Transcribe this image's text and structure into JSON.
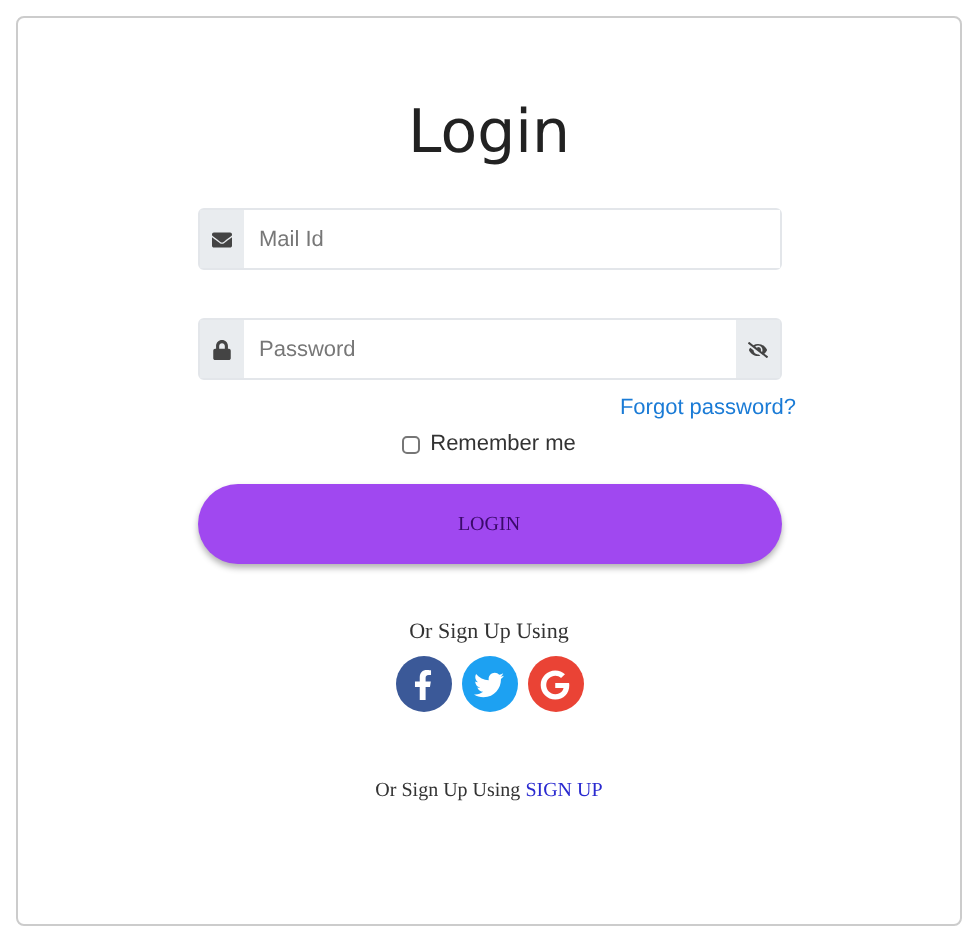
{
  "title": "Login",
  "fields": [
    {
      "kind": "email",
      "placeholder": "Mail Id"
    },
    {
      "kind": "password",
      "placeholder": "Password"
    }
  ],
  "forgot_link": "Forgot password?",
  "remember": {
    "label": "Remember me",
    "checked": false
  },
  "login_button": "LOGIN",
  "social": {
    "label": "Or Sign Up Using",
    "providers": [
      {
        "kind": "facebook",
        "color": "#3b5998"
      },
      {
        "kind": "twitter",
        "color": "#1da1f2"
      },
      {
        "kind": "google",
        "color": "#ea4335"
      }
    ]
  },
  "footer": {
    "text": "Or Sign Up Using",
    "link": "SIGN UP"
  }
}
